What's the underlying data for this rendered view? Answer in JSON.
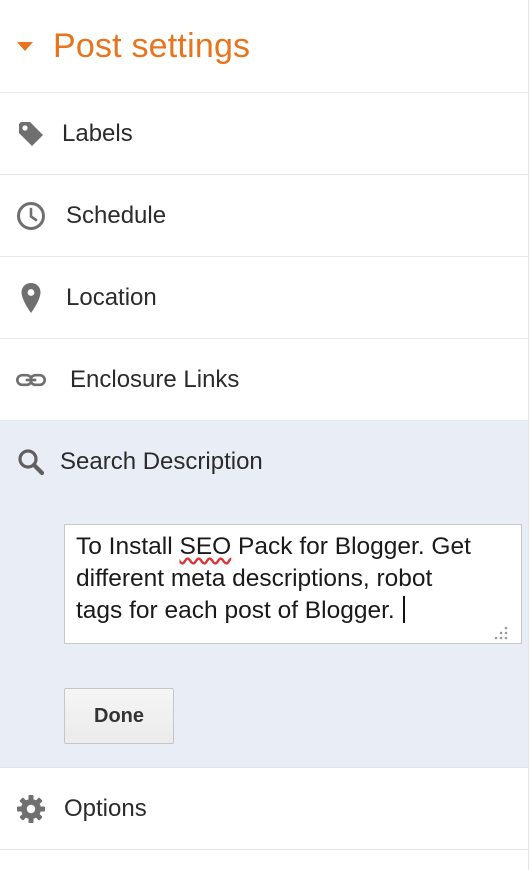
{
  "header": {
    "title": "Post settings"
  },
  "items": {
    "labels": {
      "label": "Labels",
      "icon": "tag-icon"
    },
    "schedule": {
      "label": "Schedule",
      "icon": "clock-icon"
    },
    "location": {
      "label": "Location",
      "icon": "map-pin-icon"
    },
    "enclosure": {
      "label": "Enclosure Links",
      "icon": "link-icon"
    },
    "search": {
      "label": "Search Description",
      "icon": "search-icon"
    },
    "options": {
      "label": "Options",
      "icon": "gear-icon"
    }
  },
  "search_description": {
    "line1_pre": "To Install ",
    "line1_misspelled": "SEO",
    "line1_post": " Pack for Blogger. Get",
    "line2": "different meta descriptions, robot",
    "line3": "tags for each post of Blogger."
  },
  "done_button": {
    "label": "Done"
  },
  "colors": {
    "accent": "#e8741d",
    "active_section_bg": "#e9eef6",
    "icon_gray": "#6f6f6f"
  }
}
